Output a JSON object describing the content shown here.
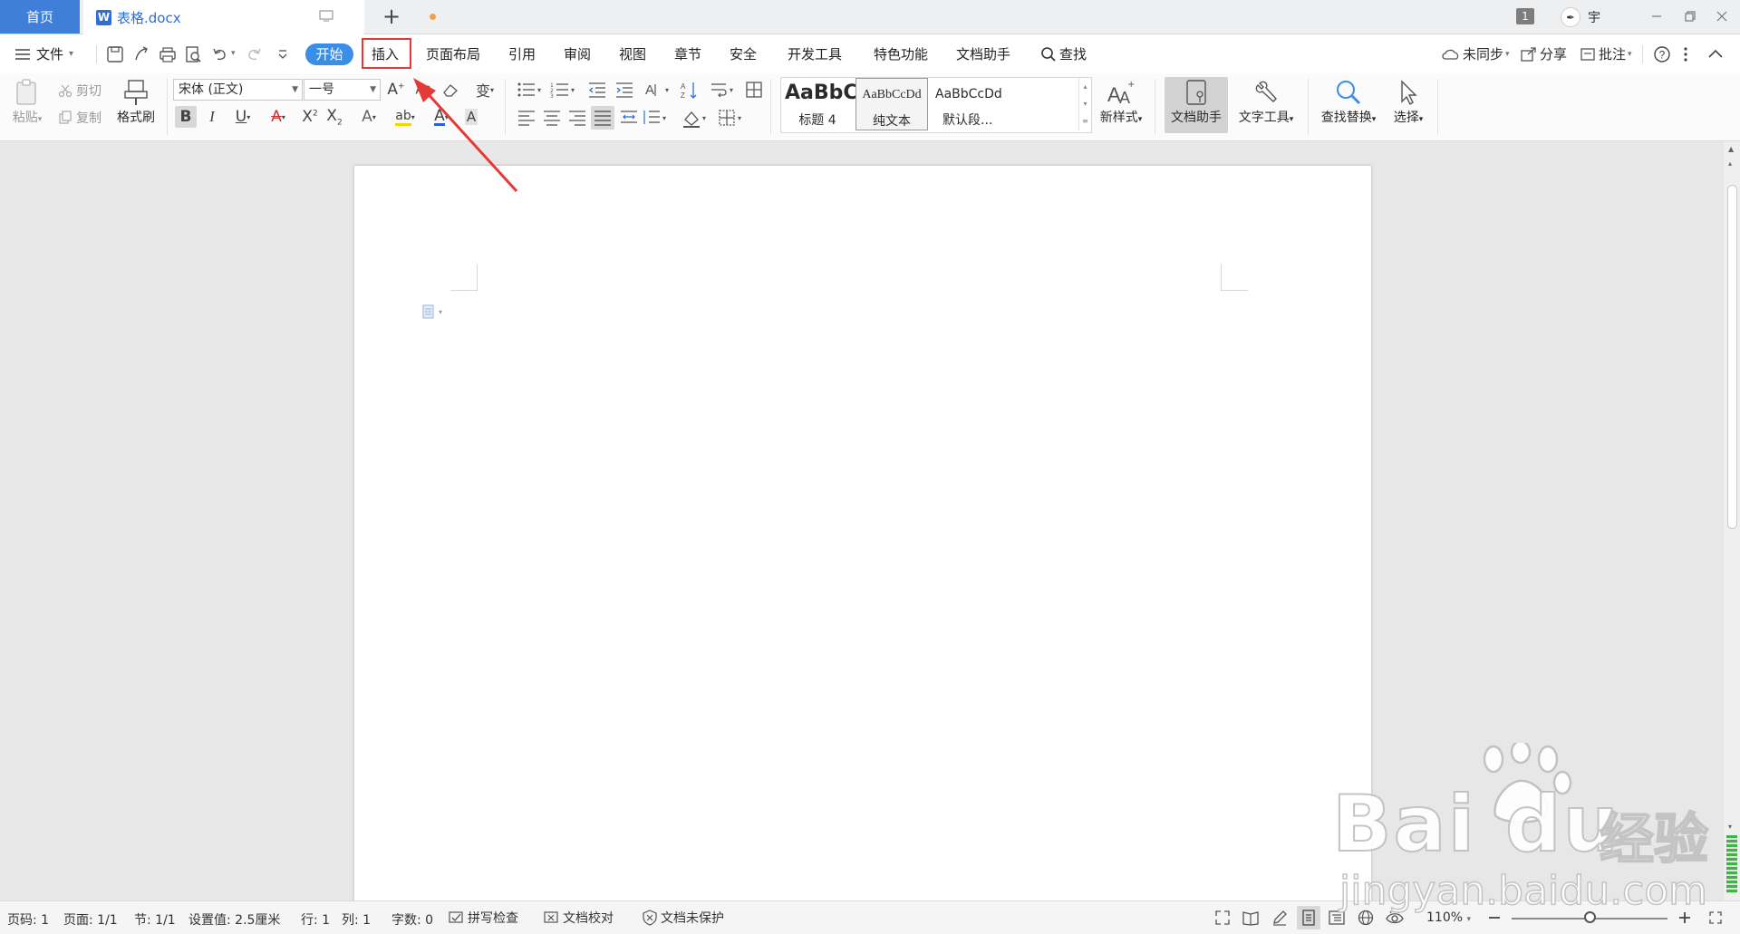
{
  "tabs": {
    "home": "首页",
    "document_title": "表格.docx",
    "window_count": "1",
    "user_name": "宇"
  },
  "menu": {
    "file": "文件",
    "items": [
      "开始",
      "插入",
      "页面布局",
      "引用",
      "审阅",
      "视图",
      "章节",
      "安全",
      "开发工具",
      "特色功能",
      "文档助手"
    ],
    "search": "查找",
    "sync": "未同步",
    "share": "分享",
    "comment": "批注"
  },
  "ribbon": {
    "paste": "粘贴",
    "cut": "剪切",
    "copy": "复制",
    "format_painter": "格式刷",
    "font_name": "宋体 (正文)",
    "font_size": "一号",
    "styles": [
      {
        "sample": "AaBbC",
        "name": "标题 4"
      },
      {
        "sample": "AaBbCcDd",
        "name": "纯文本"
      },
      {
        "sample": "AaBbCcDd",
        "name": "默认段..."
      }
    ],
    "new_style": "新样式",
    "doc_assistant": "文档助手",
    "text_tools": "文字工具",
    "find_replace": "查找替换",
    "select": "选择"
  },
  "status": {
    "page": "页码: 1",
    "pages": "页面: 1/1",
    "section": "节: 1/1",
    "setting": "设置值: 2.5厘米",
    "row": "行: 1",
    "col": "列: 1",
    "words": "字数: 0",
    "spell_check": "拼写检查",
    "proofread": "文档校对",
    "protect": "文档未保护",
    "zoom": "110%"
  },
  "watermark": {
    "brand": "Bai du",
    "cn": "经验",
    "url": "jingyan.baidu.com"
  },
  "colors": {
    "accent": "#3f7fd9",
    "start_pill": "#3a8ee6",
    "highlight_box": "#e53935"
  }
}
